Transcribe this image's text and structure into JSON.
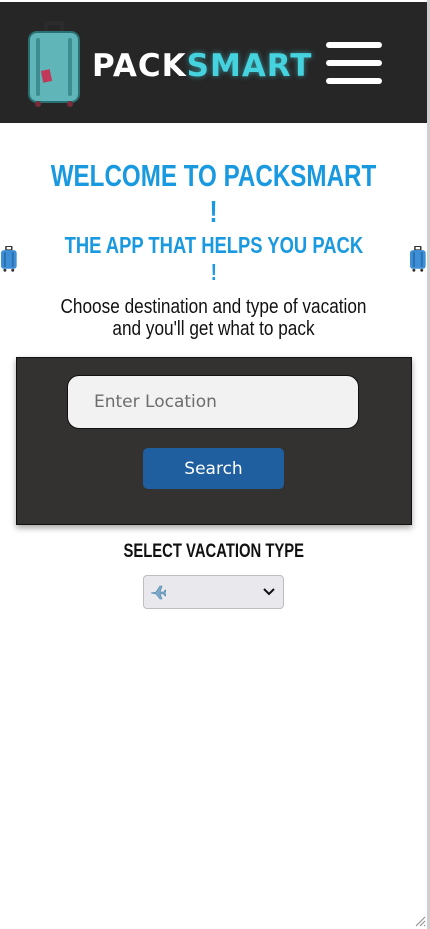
{
  "header": {
    "brand_pack": "PACK",
    "brand_smart": "SMART",
    "logo_icon": "suitcase-icon",
    "menu_icon": "hamburger-menu-icon"
  },
  "main": {
    "welcome_title": "WELCOME TO PACKSMART !",
    "tagline": "THE APP THAT HELPS YOU PACK !",
    "tagline_icon": "luggage-icon",
    "instructions": "Choose destination and type of vacation and you'll get what to pack"
  },
  "search": {
    "placeholder": "Enter Location",
    "button_label": "Search"
  },
  "vacation": {
    "label": "SELECT VACATION TYPE",
    "selected_icon": "airplane-icon"
  },
  "colors": {
    "header_bg": "#262626",
    "accent": "#1899e0",
    "brand_smart": "#45d3df",
    "panel_bg": "#333230",
    "button_bg": "#1f5fa0"
  }
}
